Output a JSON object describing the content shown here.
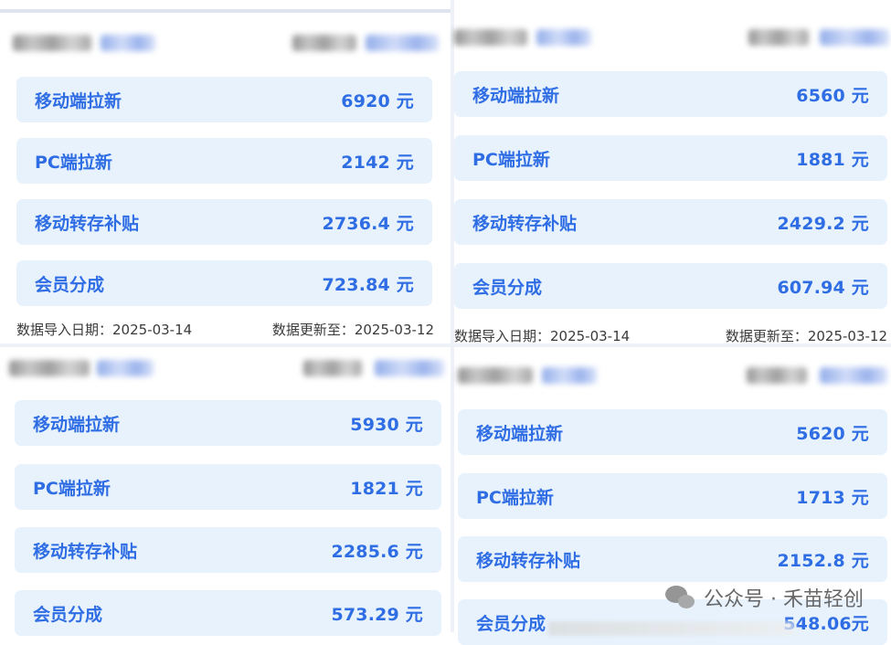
{
  "panels": [
    {
      "rows": [
        {
          "label": "移动端拉新",
          "value": "6920 元"
        },
        {
          "label": "PC端拉新",
          "value": "2142 元"
        },
        {
          "label": "移动转存补贴",
          "value": "2736.4 元"
        },
        {
          "label": "会员分成",
          "value": "723.84 元"
        }
      ],
      "footer": {
        "import_date": "数据导入日期：2025-03-14",
        "updated_to": "数据更新至：2025-03-12"
      }
    },
    {
      "rows": [
        {
          "label": "移动端拉新",
          "value": "6560 元"
        },
        {
          "label": "PC端拉新",
          "value": "1881 元"
        },
        {
          "label": "移动转存补贴",
          "value": "2429.2 元"
        },
        {
          "label": "会员分成",
          "value": "607.94 元"
        }
      ],
      "footer": {
        "import_date": "数据导入日期：2025-03-14",
        "updated_to": "数据更新至：2025-03-12"
      }
    },
    {
      "rows": [
        {
          "label": "移动端拉新",
          "value": "5930 元"
        },
        {
          "label": "PC端拉新",
          "value": "1821 元"
        },
        {
          "label": "移动转存补贴",
          "value": "2285.6 元"
        },
        {
          "label": "会员分成",
          "value": "573.29 元"
        }
      ]
    },
    {
      "rows": [
        {
          "label": "移动端拉新",
          "value": "5620 元"
        },
        {
          "label": "PC端拉新",
          "value": "1713 元"
        },
        {
          "label": "移动转存补贴",
          "value": "2152.8 元"
        },
        {
          "label": "会员分成",
          "value": "548.06元"
        }
      ]
    }
  ],
  "watermark": {
    "text": "公众号 · 禾苗轻创",
    "icon": "wechat-icon"
  },
  "colors": {
    "row_bg": "#e7f2fd",
    "accent": "#2f6de4"
  }
}
